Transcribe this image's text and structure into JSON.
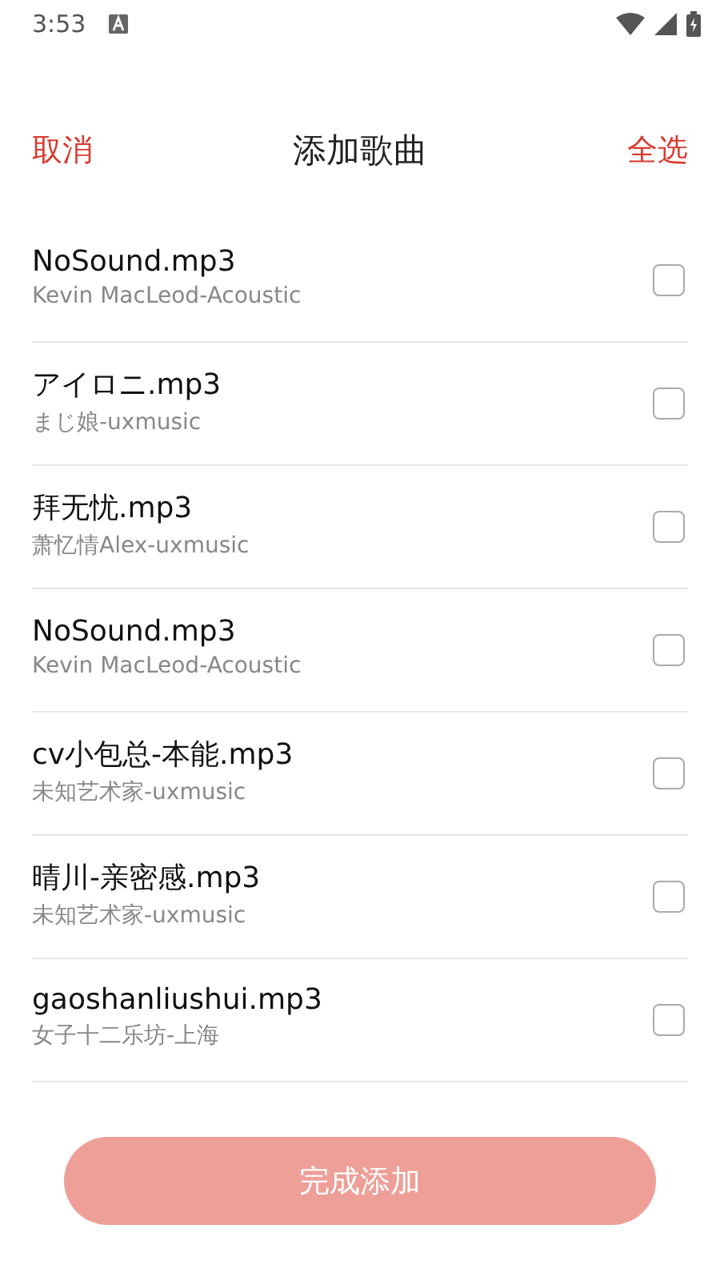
{
  "status_bar": {
    "time": "3:53"
  },
  "header": {
    "cancel": "取消",
    "title": "添加歌曲",
    "select_all": "全选"
  },
  "songs": [
    {
      "title": "NoSound.mp3",
      "artist": "Kevin MacLeod-Acoustic",
      "checked": false
    },
    {
      "title": "アイロニ.mp3",
      "artist": "まじ娘-uxmusic",
      "checked": false
    },
    {
      "title": "拜无忧.mp3",
      "artist": "萧忆情Alex-uxmusic",
      "checked": false
    },
    {
      "title": "NoSound.mp3",
      "artist": "Kevin MacLeod-Acoustic",
      "checked": false
    },
    {
      "title": "cv小包总-本能.mp3",
      "artist": "未知艺术家-uxmusic",
      "checked": false
    },
    {
      "title": "晴川-亲密感.mp3",
      "artist": "未知艺术家-uxmusic",
      "checked": false
    },
    {
      "title": "gaoshanliushui.mp3",
      "artist": "女子十二乐坊-上海",
      "checked": false
    }
  ],
  "done_button": {
    "label": "完成添加",
    "disabled": true
  }
}
